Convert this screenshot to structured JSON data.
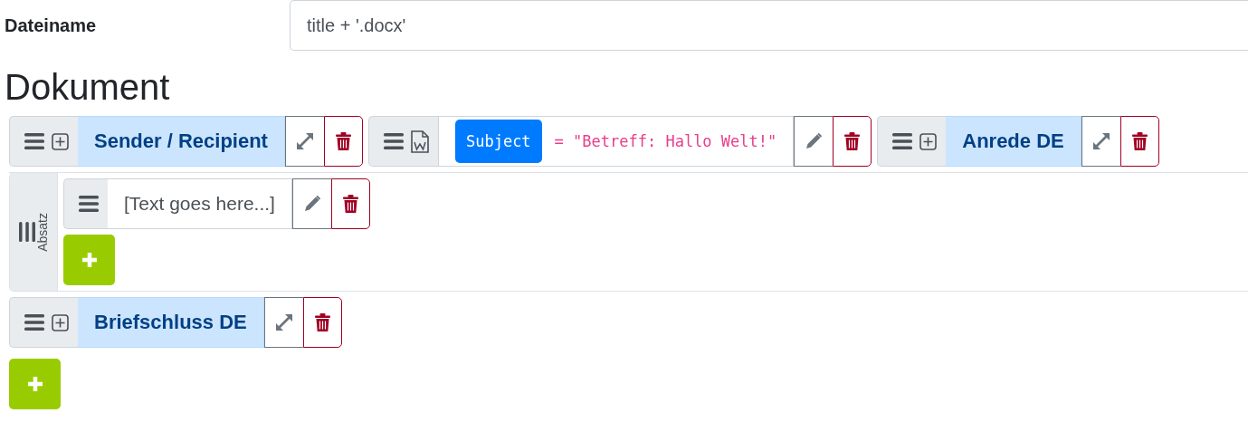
{
  "field": {
    "label": "Dateiname",
    "value": "title + '.docx'"
  },
  "heading": "Dokument",
  "rows": [
    {
      "kind": "inline",
      "items": [
        {
          "kind": "block",
          "label": "Sender / Recipient"
        },
        {
          "kind": "variable",
          "name": "Subject",
          "value": "= \"Betreff: Hallo Welt!\""
        },
        {
          "kind": "block",
          "label": "Anrede DE"
        }
      ]
    },
    {
      "kind": "group",
      "label": "Absatz",
      "items": [
        {
          "kind": "text",
          "text": "[Text goes here...]"
        }
      ]
    },
    {
      "kind": "inline",
      "items": [
        {
          "kind": "block",
          "label": "Briefschluss DE"
        }
      ]
    }
  ]
}
